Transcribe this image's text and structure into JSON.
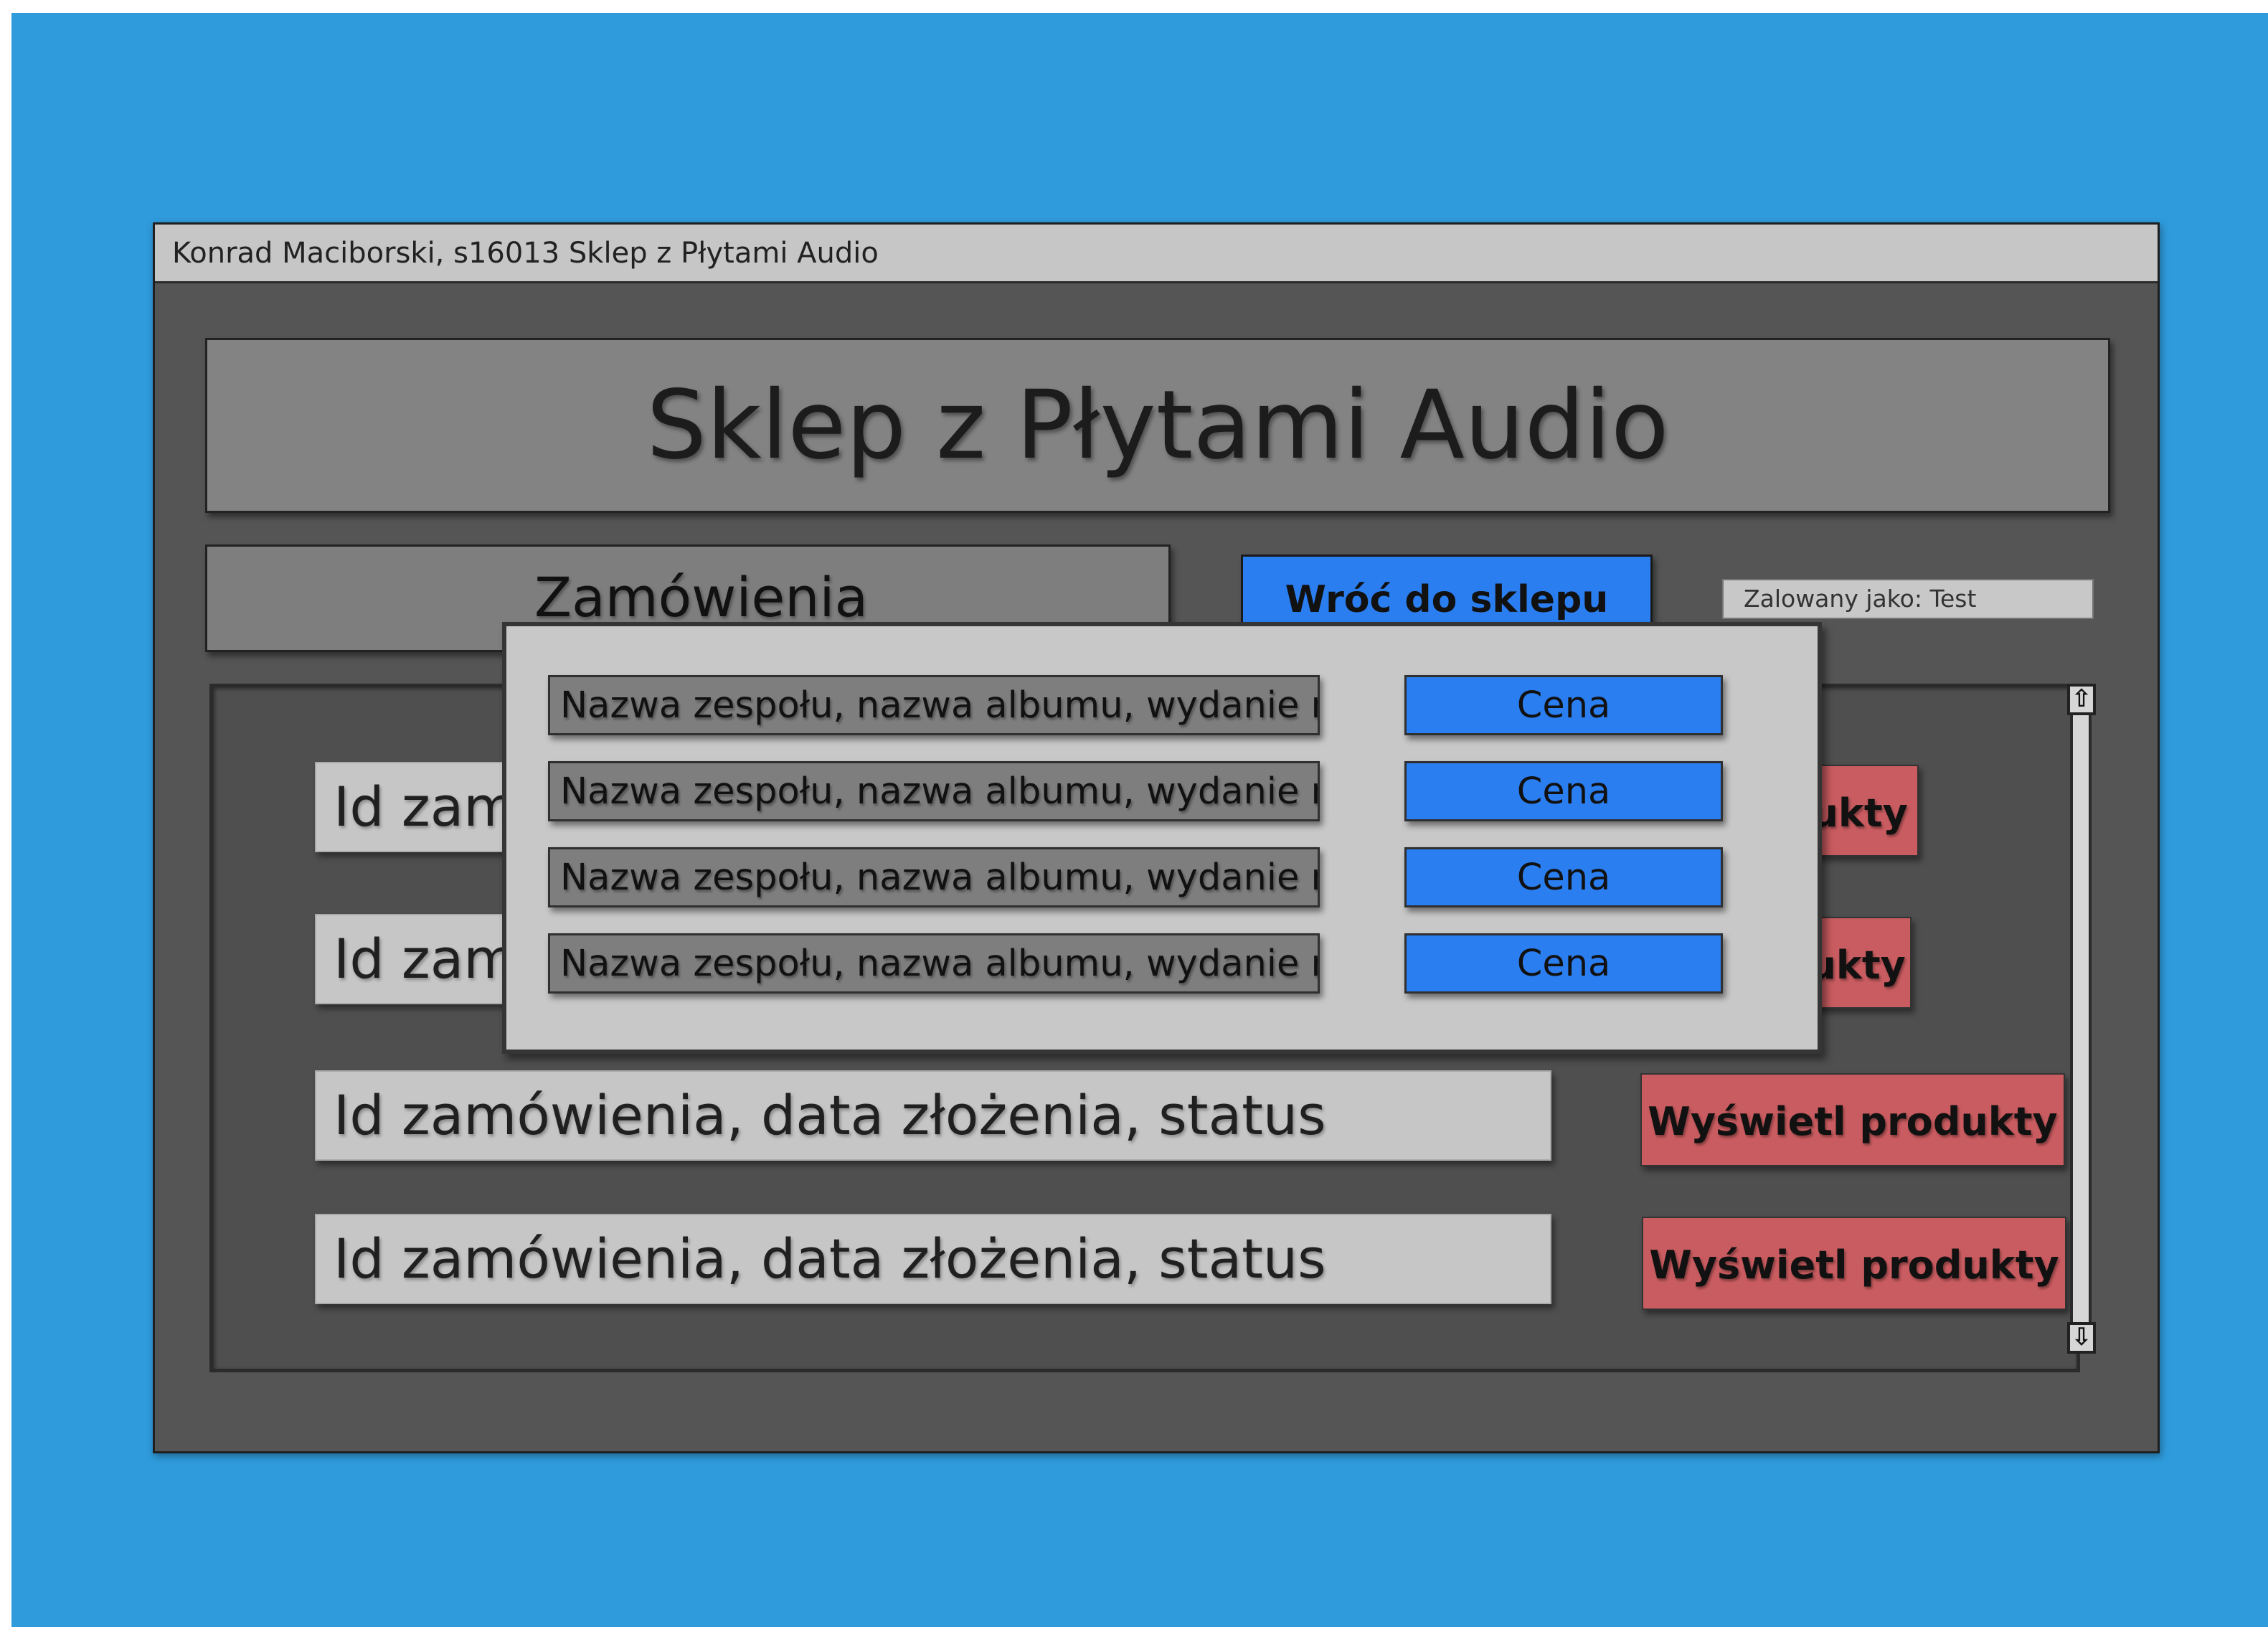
{
  "window": {
    "title": "Konrad Maciborski, s16013 Sklep z Płytami Audio"
  },
  "header": {
    "title": "Sklep z Płytami Audio"
  },
  "section": {
    "title": "Zamówienia"
  },
  "nav": {
    "back_label": "Wróć do sklepu"
  },
  "user": {
    "logged_in_label": "Zalowany jako: Test"
  },
  "orders": [
    {
      "info": "Id zamów",
      "button": "rodukty"
    },
    {
      "info": "Id zamów",
      "button": "rodukty"
    },
    {
      "info": "Id zamówienia, data złożenia, status",
      "button": "Wyświetl produkty"
    },
    {
      "info": "Id zamówienia, data złożenia, status",
      "button": "Wyświetl produkty"
    }
  ],
  "scrollbar": {
    "up_icon": "arrow-up-icon",
    "down_icon": "arrow-down-icon"
  },
  "modal": {
    "products": [
      {
        "name": "Nazwa zespołu, nazwa albumu, wydanie na",
        "price": "Cena"
      },
      {
        "name": "Nazwa zespołu, nazwa albumu, wydanie na",
        "price": "Cena"
      },
      {
        "name": "Nazwa zespołu, nazwa albumu, wydanie na",
        "price": "Cena"
      },
      {
        "name": "Nazwa zespołu, nazwa albumu, wydanie na",
        "price": "Cena"
      }
    ]
  },
  "colors": {
    "background": "#2f9bdc",
    "window": "#555555",
    "accent_blue": "#2b7ef0",
    "accent_red": "#c95c60"
  }
}
